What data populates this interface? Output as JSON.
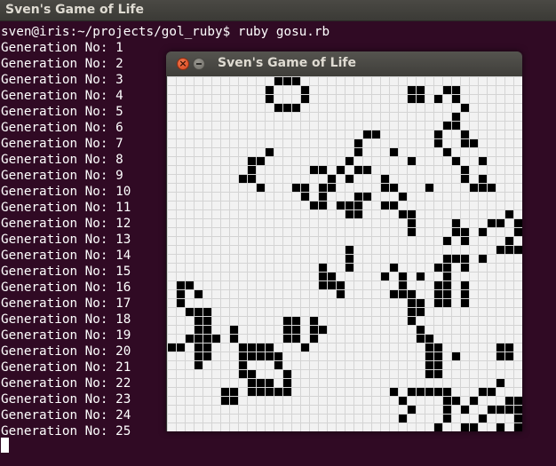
{
  "terminal": {
    "title": "Sven's Game of Life",
    "prompt": "sven@iris:~/projects/gol_ruby$ ruby gosu.rb",
    "output_lines": [
      "Generation No: 1",
      "Generation No: 2",
      "Generation No: 3",
      "Generation No: 4",
      "Generation No: 5",
      "Generation No: 6",
      "Generation No: 7",
      "Generation No: 8",
      "Generation No: 9",
      "Generation No: 10",
      "Generation No: 11",
      "Generation No: 12",
      "Generation No: 13",
      "Generation No: 14",
      "Generation No: 15",
      "Generation No: 16",
      "Generation No: 17",
      "Generation No: 18",
      "Generation No: 19",
      "Generation No: 20",
      "Generation No: 21",
      "Generation No: 22",
      "Generation No: 23",
      "Generation No: 24",
      "Generation No: 25"
    ]
  },
  "game_window": {
    "title": "Sven's Game of Life",
    "close_glyph": "×",
    "grid_cols": 40,
    "grid_rows": 40,
    "live_cells": [
      [
        12,
        0
      ],
      [
        13,
        0
      ],
      [
        14,
        0
      ],
      [
        11,
        1
      ],
      [
        15,
        1
      ],
      [
        11,
        2
      ],
      [
        15,
        2
      ],
      [
        12,
        3
      ],
      [
        13,
        3
      ],
      [
        14,
        3
      ],
      [
        27,
        1
      ],
      [
        28,
        1
      ],
      [
        31,
        1
      ],
      [
        32,
        1
      ],
      [
        27,
        2
      ],
      [
        28,
        2
      ],
      [
        30,
        2
      ],
      [
        32,
        2
      ],
      [
        33,
        3
      ],
      [
        32,
        4
      ],
      [
        31,
        5
      ],
      [
        32,
        5
      ],
      [
        30,
        6
      ],
      [
        33,
        6
      ],
      [
        22,
        6
      ],
      [
        23,
        6
      ],
      [
        21,
        7
      ],
      [
        30,
        7
      ],
      [
        33,
        7
      ],
      [
        34,
        7
      ],
      [
        11,
        8
      ],
      [
        21,
        8
      ],
      [
        25,
        8
      ],
      [
        31,
        8
      ],
      [
        9,
        9
      ],
      [
        10,
        9
      ],
      [
        20,
        9
      ],
      [
        27,
        9
      ],
      [
        32,
        9
      ],
      [
        35,
        9
      ],
      [
        9,
        10
      ],
      [
        16,
        10
      ],
      [
        17,
        10
      ],
      [
        19,
        10
      ],
      [
        21,
        10
      ],
      [
        22,
        10
      ],
      [
        33,
        10
      ],
      [
        8,
        11
      ],
      [
        9,
        11
      ],
      [
        18,
        11
      ],
      [
        20,
        11
      ],
      [
        24,
        11
      ],
      [
        33,
        11
      ],
      [
        35,
        11
      ],
      [
        10,
        12
      ],
      [
        14,
        12
      ],
      [
        15,
        12
      ],
      [
        17,
        12
      ],
      [
        18,
        12
      ],
      [
        24,
        12
      ],
      [
        25,
        12
      ],
      [
        29,
        12
      ],
      [
        34,
        12
      ],
      [
        35,
        12
      ],
      [
        36,
        12
      ],
      [
        15,
        13
      ],
      [
        17,
        13
      ],
      [
        21,
        13
      ],
      [
        22,
        13
      ],
      [
        26,
        13
      ],
      [
        16,
        14
      ],
      [
        17,
        14
      ],
      [
        19,
        14
      ],
      [
        20,
        14
      ],
      [
        21,
        14
      ],
      [
        24,
        14
      ],
      [
        25,
        14
      ],
      [
        20,
        15
      ],
      [
        21,
        15
      ],
      [
        26,
        15
      ],
      [
        27,
        15
      ],
      [
        38,
        15
      ],
      [
        27,
        16
      ],
      [
        32,
        16
      ],
      [
        36,
        16
      ],
      [
        37,
        16
      ],
      [
        39,
        16
      ],
      [
        27,
        17
      ],
      [
        32,
        17
      ],
      [
        33,
        17
      ],
      [
        35,
        17
      ],
      [
        39,
        17
      ],
      [
        31,
        18
      ],
      [
        33,
        18
      ],
      [
        38,
        18
      ],
      [
        20,
        19
      ],
      [
        37,
        19
      ],
      [
        38,
        19
      ],
      [
        39,
        19
      ],
      [
        20,
        20
      ],
      [
        31,
        20
      ],
      [
        32,
        20
      ],
      [
        33,
        20
      ],
      [
        35,
        20
      ],
      [
        17,
        21
      ],
      [
        20,
        21
      ],
      [
        25,
        21
      ],
      [
        30,
        21
      ],
      [
        31,
        21
      ],
      [
        33,
        21
      ],
      [
        17,
        22
      ],
      [
        18,
        22
      ],
      [
        24,
        22
      ],
      [
        26,
        22
      ],
      [
        28,
        22
      ],
      [
        31,
        22
      ],
      [
        1,
        23
      ],
      [
        2,
        23
      ],
      [
        17,
        23
      ],
      [
        18,
        23
      ],
      [
        19,
        23
      ],
      [
        26,
        23
      ],
      [
        30,
        23
      ],
      [
        31,
        23
      ],
      [
        33,
        23
      ],
      [
        1,
        24
      ],
      [
        3,
        24
      ],
      [
        19,
        24
      ],
      [
        25,
        24
      ],
      [
        26,
        24
      ],
      [
        27,
        24
      ],
      [
        30,
        24
      ],
      [
        31,
        24
      ],
      [
        33,
        24
      ],
      [
        1,
        25
      ],
      [
        27,
        25
      ],
      [
        28,
        25
      ],
      [
        30,
        25
      ],
      [
        31,
        25
      ],
      [
        33,
        25
      ],
      [
        2,
        26
      ],
      [
        3,
        26
      ],
      [
        4,
        26
      ],
      [
        27,
        26
      ],
      [
        28,
        26
      ],
      [
        3,
        27
      ],
      [
        4,
        27
      ],
      [
        13,
        27
      ],
      [
        14,
        27
      ],
      [
        16,
        27
      ],
      [
        27,
        27
      ],
      [
        3,
        28
      ],
      [
        4,
        28
      ],
      [
        7,
        28
      ],
      [
        13,
        28
      ],
      [
        14,
        28
      ],
      [
        16,
        28
      ],
      [
        17,
        28
      ],
      [
        28,
        28
      ],
      [
        2,
        29
      ],
      [
        3,
        29
      ],
      [
        4,
        29
      ],
      [
        5,
        29
      ],
      [
        7,
        29
      ],
      [
        13,
        29
      ],
      [
        14,
        29
      ],
      [
        16,
        29
      ],
      [
        28,
        29
      ],
      [
        29,
        29
      ],
      [
        0,
        30
      ],
      [
        1,
        30
      ],
      [
        3,
        30
      ],
      [
        4,
        30
      ],
      [
        8,
        30
      ],
      [
        9,
        30
      ],
      [
        10,
        30
      ],
      [
        11,
        30
      ],
      [
        15,
        30
      ],
      [
        29,
        30
      ],
      [
        30,
        30
      ],
      [
        37,
        30
      ],
      [
        38,
        30
      ],
      [
        3,
        31
      ],
      [
        4,
        31
      ],
      [
        8,
        31
      ],
      [
        9,
        31
      ],
      [
        10,
        31
      ],
      [
        11,
        31
      ],
      [
        12,
        31
      ],
      [
        29,
        31
      ],
      [
        30,
        31
      ],
      [
        32,
        31
      ],
      [
        37,
        31
      ],
      [
        38,
        31
      ],
      [
        3,
        32
      ],
      [
        8,
        32
      ],
      [
        12,
        32
      ],
      [
        29,
        32
      ],
      [
        30,
        32
      ],
      [
        8,
        33
      ],
      [
        9,
        33
      ],
      [
        13,
        33
      ],
      [
        29,
        33
      ],
      [
        30,
        33
      ],
      [
        9,
        34
      ],
      [
        10,
        34
      ],
      [
        11,
        34
      ],
      [
        13,
        34
      ],
      [
        37,
        34
      ],
      [
        6,
        35
      ],
      [
        7,
        35
      ],
      [
        9,
        35
      ],
      [
        10,
        35
      ],
      [
        11,
        35
      ],
      [
        12,
        35
      ],
      [
        13,
        35
      ],
      [
        25,
        35
      ],
      [
        27,
        35
      ],
      [
        28,
        35
      ],
      [
        29,
        35
      ],
      [
        30,
        35
      ],
      [
        31,
        35
      ],
      [
        35,
        35
      ],
      [
        36,
        35
      ],
      [
        6,
        36
      ],
      [
        7,
        36
      ],
      [
        26,
        36
      ],
      [
        31,
        36
      ],
      [
        32,
        36
      ],
      [
        34,
        36
      ],
      [
        38,
        36
      ],
      [
        39,
        36
      ],
      [
        27,
        37
      ],
      [
        31,
        37
      ],
      [
        33,
        37
      ],
      [
        36,
        37
      ],
      [
        37,
        37
      ],
      [
        38,
        37
      ],
      [
        39,
        37
      ],
      [
        26,
        38
      ],
      [
        31,
        38
      ],
      [
        35,
        38
      ],
      [
        39,
        38
      ],
      [
        30,
        39
      ],
      [
        33,
        39
      ],
      [
        34,
        39
      ],
      [
        37,
        39
      ],
      [
        39,
        39
      ],
      [
        30,
        40
      ],
      [
        35,
        40
      ],
      [
        38,
        40
      ],
      [
        39,
        40
      ]
    ]
  }
}
